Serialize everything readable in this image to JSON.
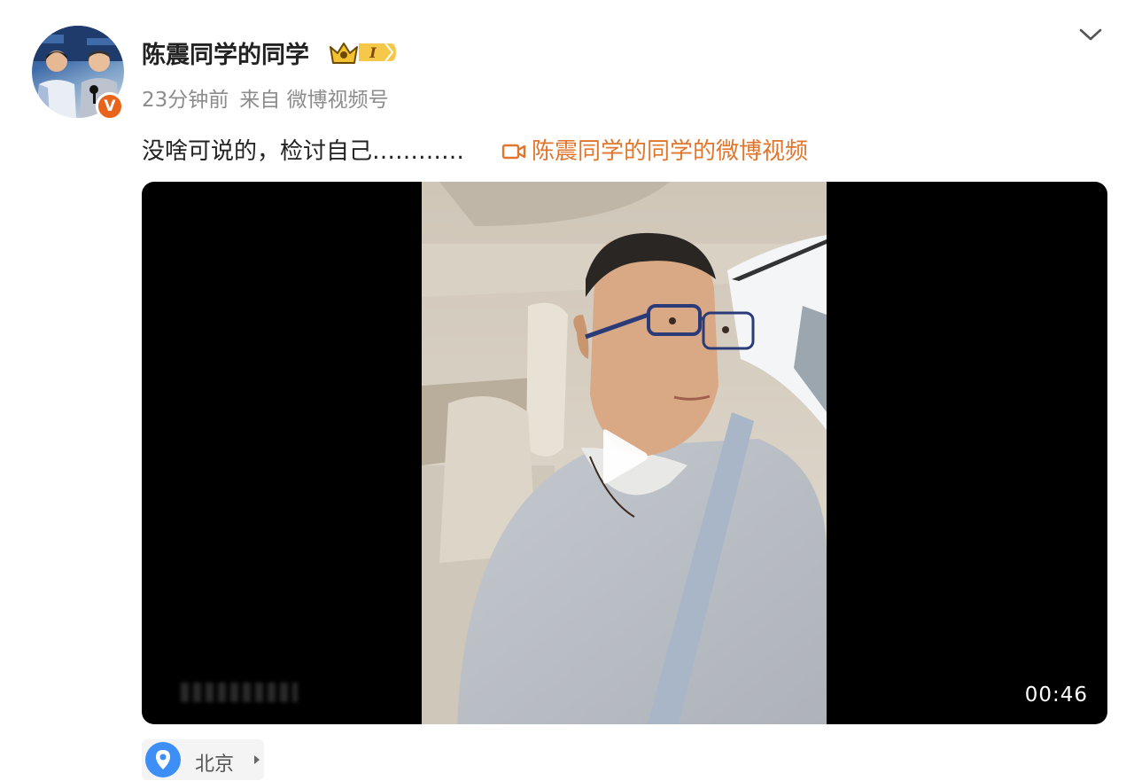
{
  "post": {
    "username": "陈震同学的同学",
    "vip_level": "I",
    "time": "23分钟前",
    "source": "来自 微博视频号",
    "text": "没啥可说的，检讨自己…………",
    "video_link": "陈震同学的同学的微博视频"
  },
  "video": {
    "duration": "00:46"
  },
  "location": {
    "label": "北京"
  },
  "icons": {
    "verified": "verified-v-icon",
    "vip": "crown-vip-icon",
    "more": "chevron-down-icon",
    "video": "video-camera-icon",
    "play": "play-icon",
    "location": "location-pin-icon"
  },
  "colors": {
    "accent": "#e0762e",
    "verified": "#e8631b",
    "location_pin": "#3d8ff5",
    "meta_text": "#8c8c8c"
  }
}
